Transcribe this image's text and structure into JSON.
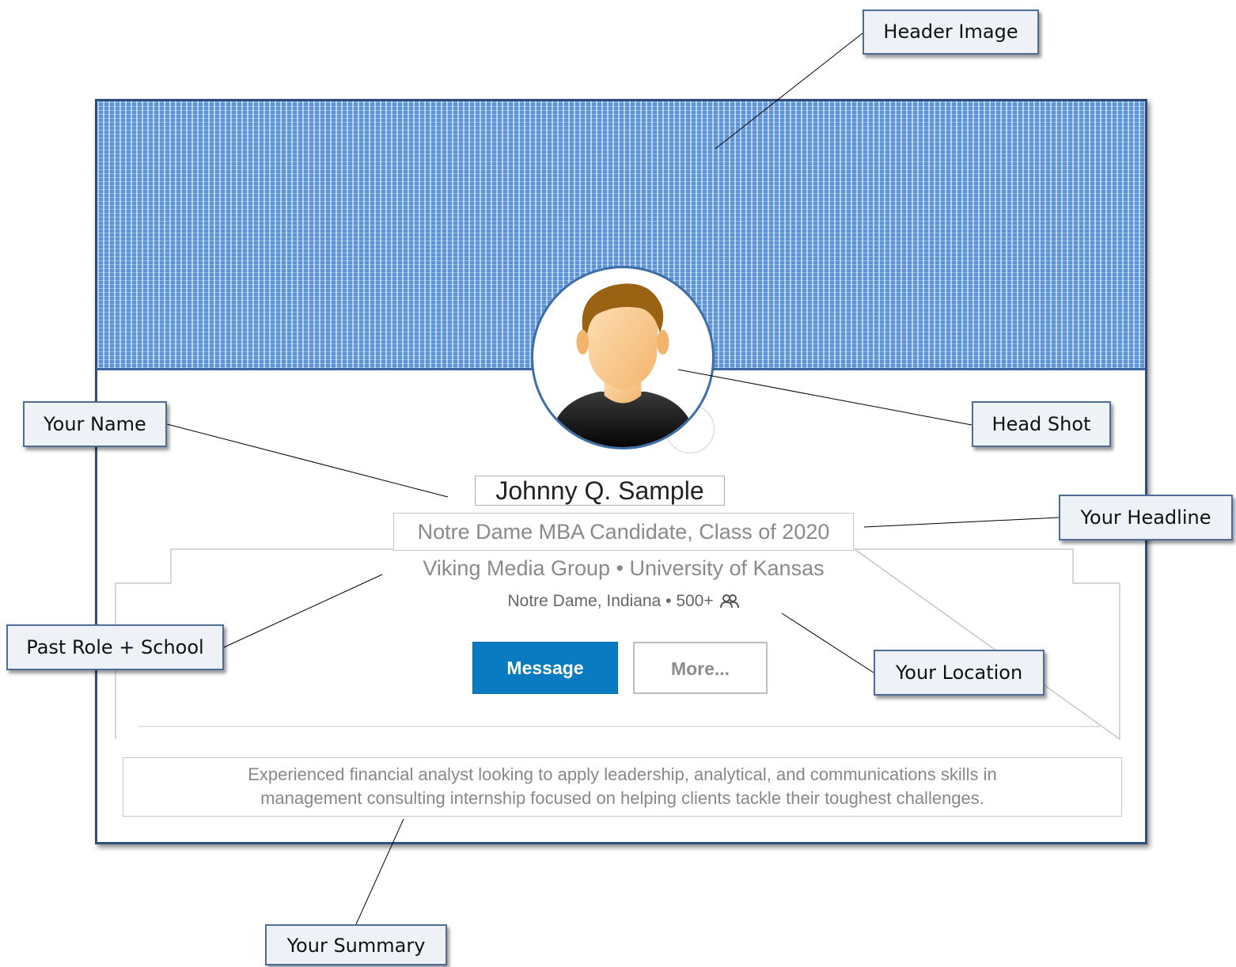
{
  "profile": {
    "name": "Johnny Q. Sample",
    "headline": "Notre Dame MBA Candidate, Class of 2020",
    "past_role_school": "Viking Media Group  •  University of Kansas",
    "location": "Notre Dame, Indiana",
    "location_separator": "•",
    "connections": "500+",
    "connections_icon": "connections-icon",
    "message_button": "Message",
    "more_button": "More...",
    "summary_line1": "Experienced financial analyst looking to apply leadership, analytical, and communications skills in",
    "summary_line2": "management consulting internship focused on helping clients tackle their toughest challenges."
  },
  "callouts": {
    "header_image": "Header Image",
    "head_shot": "Head Shot",
    "your_name": "Your Name",
    "your_headline": "Your Headline",
    "past_role_school": "Past Role + School",
    "your_location": "Your Location",
    "your_summary": "Your Summary"
  },
  "colors": {
    "header_blue": "#5b93d6",
    "message_button": "#0b7bc1",
    "callout_fill": "#eef1f6",
    "callout_border": "#4e6c96"
  }
}
